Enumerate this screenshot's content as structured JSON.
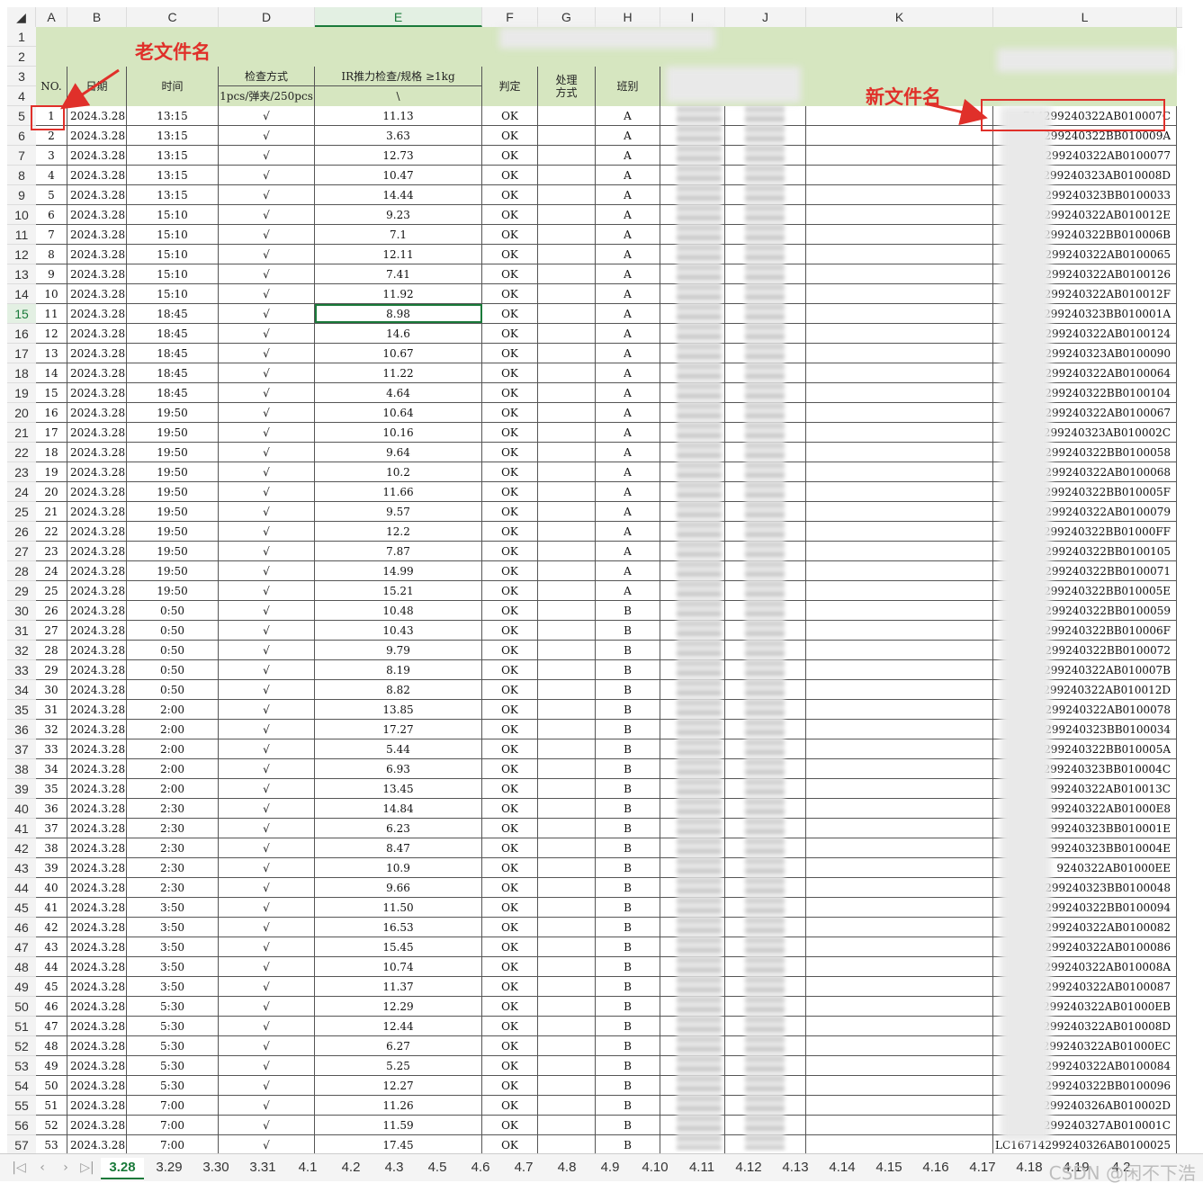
{
  "columns": [
    "A",
    "B",
    "C",
    "D",
    "E",
    "F",
    "G",
    "H",
    "I",
    "J",
    "K",
    "L"
  ],
  "selected_column": "E",
  "selected_row": "15",
  "annotations": {
    "old_name": "老文件名",
    "new_name": "新文件名"
  },
  "headers": {
    "no": "NO.",
    "date": "日期",
    "time": "时间",
    "method": "检查方式",
    "method_sub": "1pcs/弹夹/250pcs",
    "ir": "IR推力检查/规格 ≥1kg",
    "ir_sub": "\\",
    "judge": "判定",
    "handle": "处理方式",
    "shift": "班别"
  },
  "rows": [
    {
      "r": "5",
      "no": "1",
      "date": "2024.3.28",
      "time": "13:15",
      "chk": "√",
      "val": "11.13",
      "res": "OK",
      "shift": "A",
      "code": "714299240322AB010007C"
    },
    {
      "r": "6",
      "no": "2",
      "date": "2024.3.28",
      "time": "13:15",
      "chk": "√",
      "val": "3.63",
      "res": "OK",
      "shift": "A",
      "code": "714299240322BB010009A"
    },
    {
      "r": "7",
      "no": "3",
      "date": "2024.3.28",
      "time": "13:15",
      "chk": "√",
      "val": "12.73",
      "res": "OK",
      "shift": "A",
      "code": "714299240322AB0100077"
    },
    {
      "r": "8",
      "no": "4",
      "date": "2024.3.28",
      "time": "13:15",
      "chk": "√",
      "val": "10.47",
      "res": "OK",
      "shift": "A",
      "code": "714299240323AB010008D"
    },
    {
      "r": "9",
      "no": "5",
      "date": "2024.3.28",
      "time": "13:15",
      "chk": "√",
      "val": "14.44",
      "res": "OK",
      "shift": "A",
      "code": "714299240323BB0100033"
    },
    {
      "r": "10",
      "no": "6",
      "date": "2024.3.28",
      "time": "15:10",
      "chk": "√",
      "val": "9.23",
      "res": "OK",
      "shift": "A",
      "code": "714299240322AB010012E"
    },
    {
      "r": "11",
      "no": "7",
      "date": "2024.3.28",
      "time": "15:10",
      "chk": "√",
      "val": "7.1",
      "res": "OK",
      "shift": "A",
      "code": "714299240322BB010006B"
    },
    {
      "r": "12",
      "no": "8",
      "date": "2024.3.28",
      "time": "15:10",
      "chk": "√",
      "val": "12.11",
      "res": "OK",
      "shift": "A",
      "code": "714299240322AB0100065"
    },
    {
      "r": "13",
      "no": "9",
      "date": "2024.3.28",
      "time": "15:10",
      "chk": "√",
      "val": "7.41",
      "res": "OK",
      "shift": "A",
      "code": "714299240322AB0100126"
    },
    {
      "r": "14",
      "no": "10",
      "date": "2024.3.28",
      "time": "15:10",
      "chk": "√",
      "val": "11.92",
      "res": "OK",
      "shift": "A",
      "code": "14299240322AB010012F"
    },
    {
      "r": "15",
      "no": "11",
      "date": "2024.3.28",
      "time": "18:45",
      "chk": "√",
      "val": "8.98",
      "res": "OK",
      "shift": "A",
      "code": "4299240323BB010001A"
    },
    {
      "r": "16",
      "no": "12",
      "date": "2024.3.28",
      "time": "18:45",
      "chk": "√",
      "val": "14.6",
      "res": "OK",
      "shift": "A",
      "code": "4299240322AB0100124"
    },
    {
      "r": "17",
      "no": "13",
      "date": "2024.3.28",
      "time": "18:45",
      "chk": "√",
      "val": "10.67",
      "res": "OK",
      "shift": "A",
      "code": "4299240323AB0100090"
    },
    {
      "r": "18",
      "no": "14",
      "date": "2024.3.28",
      "time": "18:45",
      "chk": "√",
      "val": "11.22",
      "res": "OK",
      "shift": "A",
      "code": "4299240322AB0100064"
    },
    {
      "r": "19",
      "no": "15",
      "date": "2024.3.28",
      "time": "18:45",
      "chk": "√",
      "val": "4.64",
      "res": "OK",
      "shift": "A",
      "code": "4299240322BB0100104"
    },
    {
      "r": "20",
      "no": "16",
      "date": "2024.3.28",
      "time": "19:50",
      "chk": "√",
      "val": "10.64",
      "res": "OK",
      "shift": "A",
      "code": "4299240322AB0100067"
    },
    {
      "r": "21",
      "no": "17",
      "date": "2024.3.28",
      "time": "19:50",
      "chk": "√",
      "val": "10.16",
      "res": "OK",
      "shift": "A",
      "code": "4299240323AB010002C"
    },
    {
      "r": "22",
      "no": "18",
      "date": "2024.3.28",
      "time": "19:50",
      "chk": "√",
      "val": "9.64",
      "res": "OK",
      "shift": "A",
      "code": "4299240322BB0100058"
    },
    {
      "r": "23",
      "no": "19",
      "date": "2024.3.28",
      "time": "19:50",
      "chk": "√",
      "val": "10.2",
      "res": "OK",
      "shift": "A",
      "code": "299240322AB0100068"
    },
    {
      "r": "24",
      "no": "20",
      "date": "2024.3.28",
      "time": "19:50",
      "chk": "√",
      "val": "11.66",
      "res": "OK",
      "shift": "A",
      "code": "4299240322BB010005F"
    },
    {
      "r": "25",
      "no": "21",
      "date": "2024.3.28",
      "time": "19:50",
      "chk": "√",
      "val": "9.57",
      "res": "OK",
      "shift": "A",
      "code": "4299240322AB0100079"
    },
    {
      "r": "26",
      "no": "22",
      "date": "2024.3.28",
      "time": "19:50",
      "chk": "√",
      "val": "12.2",
      "res": "OK",
      "shift": "A",
      "code": "4299240322BB01000FF"
    },
    {
      "r": "27",
      "no": "23",
      "date": "2024.3.28",
      "time": "19:50",
      "chk": "√",
      "val": "7.87",
      "res": "OK",
      "shift": "A",
      "code": "299240322BB0100105"
    },
    {
      "r": "28",
      "no": "24",
      "date": "2024.3.28",
      "time": "19:50",
      "chk": "√",
      "val": "14.99",
      "res": "OK",
      "shift": "A",
      "code": "299240322BB0100071"
    },
    {
      "r": "29",
      "no": "25",
      "date": "2024.3.28",
      "time": "19:50",
      "chk": "√",
      "val": "15.21",
      "res": "OK",
      "shift": "A",
      "code": "299240322BB010005E"
    },
    {
      "r": "30",
      "no": "26",
      "date": "2024.3.28",
      "time": "0:50",
      "chk": "√",
      "val": "10.48",
      "res": "OK",
      "shift": "B",
      "code": "299240322BB0100059"
    },
    {
      "r": "31",
      "no": "27",
      "date": "2024.3.28",
      "time": "0:50",
      "chk": "√",
      "val": "10.43",
      "res": "OK",
      "shift": "B",
      "code": "299240322BB010006F"
    },
    {
      "r": "32",
      "no": "28",
      "date": "2024.3.28",
      "time": "0:50",
      "chk": "√",
      "val": "9.79",
      "res": "OK",
      "shift": "B",
      "code": "4299240322BB0100072"
    },
    {
      "r": "33",
      "no": "29",
      "date": "2024.3.28",
      "time": "0:50",
      "chk": "√",
      "val": "8.19",
      "res": "OK",
      "shift": "B",
      "code": "4299240322AB010007B"
    },
    {
      "r": "34",
      "no": "30",
      "date": "2024.3.28",
      "time": "0:50",
      "chk": "√",
      "val": "8.82",
      "res": "OK",
      "shift": "B",
      "code": "4299240322AB010012D"
    },
    {
      "r": "35",
      "no": "31",
      "date": "2024.3.28",
      "time": "2:00",
      "chk": "√",
      "val": "13.85",
      "res": "OK",
      "shift": "B",
      "code": "4299240322AB0100078"
    },
    {
      "r": "36",
      "no": "32",
      "date": "2024.3.28",
      "time": "2:00",
      "chk": "√",
      "val": "17.27",
      "res": "OK",
      "shift": "B",
      "code": "299240323BB0100034"
    },
    {
      "r": "37",
      "no": "33",
      "date": "2024.3.28",
      "time": "2:00",
      "chk": "√",
      "val": "5.44",
      "res": "OK",
      "shift": "B",
      "code": "299240322BB010005A"
    },
    {
      "r": "38",
      "no": "34",
      "date": "2024.3.28",
      "time": "2:00",
      "chk": "√",
      "val": "6.93",
      "res": "OK",
      "shift": "B",
      "code": "299240323BB010004C"
    },
    {
      "r": "39",
      "no": "35",
      "date": "2024.3.28",
      "time": "2:00",
      "chk": "√",
      "val": "13.45",
      "res": "OK",
      "shift": "B",
      "code": "99240322AB010013C"
    },
    {
      "r": "40",
      "no": "36",
      "date": "2024.3.28",
      "time": "2:30",
      "chk": "√",
      "val": "14.84",
      "res": "OK",
      "shift": "B",
      "code": "99240322AB01000E8"
    },
    {
      "r": "41",
      "no": "37",
      "date": "2024.3.28",
      "time": "2:30",
      "chk": "√",
      "val": "6.23",
      "res": "OK",
      "shift": "B",
      "code": "99240323BB010001E"
    },
    {
      "r": "42",
      "no": "38",
      "date": "2024.3.28",
      "time": "2:30",
      "chk": "√",
      "val": "8.47",
      "res": "OK",
      "shift": "B",
      "code": "99240323BB010004E"
    },
    {
      "r": "43",
      "no": "39",
      "date": "2024.3.28",
      "time": "2:30",
      "chk": "√",
      "val": "10.9",
      "res": "OK",
      "shift": "B",
      "code": "9240322AB01000EE"
    },
    {
      "r": "44",
      "no": "40",
      "date": "2024.3.28",
      "time": "2:30",
      "chk": "√",
      "val": "9.66",
      "res": "OK",
      "shift": "B",
      "code": "4299240323BB0100048"
    },
    {
      "r": "45",
      "no": "41",
      "date": "2024.3.28",
      "time": "3:50",
      "chk": "√",
      "val": "11.50",
      "res": "OK",
      "shift": "B",
      "code": "714299240322BB0100094"
    },
    {
      "r": "46",
      "no": "42",
      "date": "2024.3.28",
      "time": "3:50",
      "chk": "√",
      "val": "16.53",
      "res": "OK",
      "shift": "B",
      "code": "714299240322AB0100082"
    },
    {
      "r": "47",
      "no": "43",
      "date": "2024.3.28",
      "time": "3:50",
      "chk": "√",
      "val": "15.45",
      "res": "OK",
      "shift": "B",
      "code": "14299240322AB0100086"
    },
    {
      "r": "48",
      "no": "44",
      "date": "2024.3.28",
      "time": "3:50",
      "chk": "√",
      "val": "10.74",
      "res": "OK",
      "shift": "B",
      "code": "14299240322AB010008A"
    },
    {
      "r": "49",
      "no": "45",
      "date": "2024.3.28",
      "time": "3:50",
      "chk": "√",
      "val": "11.37",
      "res": "OK",
      "shift": "B",
      "code": "14299240322AB0100087"
    },
    {
      "r": "50",
      "no": "46",
      "date": "2024.3.28",
      "time": "5:30",
      "chk": "√",
      "val": "12.29",
      "res": "OK",
      "shift": "B",
      "code": "14299240322AB01000EB"
    },
    {
      "r": "51",
      "no": "47",
      "date": "2024.3.28",
      "time": "5:30",
      "chk": "√",
      "val": "12.44",
      "res": "OK",
      "shift": "B",
      "code": "4299240322AB010008D"
    },
    {
      "r": "52",
      "no": "48",
      "date": "2024.3.28",
      "time": "5:30",
      "chk": "√",
      "val": "6.27",
      "res": "OK",
      "shift": "B",
      "code": "4299240322AB01000EC"
    },
    {
      "r": "53",
      "no": "49",
      "date": "2024.3.28",
      "time": "5:30",
      "chk": "√",
      "val": "5.25",
      "res": "OK",
      "shift": "B",
      "code": "4299240322AB0100084"
    },
    {
      "r": "54",
      "no": "50",
      "date": "2024.3.28",
      "time": "5:30",
      "chk": "√",
      "val": "12.27",
      "res": "OK",
      "shift": "B",
      "code": "4299240322BB0100096"
    },
    {
      "r": "55",
      "no": "51",
      "date": "2024.3.28",
      "time": "7:00",
      "chk": "√",
      "val": "11.26",
      "res": "OK",
      "shift": "B",
      "code": "4299240326AB010002D"
    },
    {
      "r": "56",
      "no": "52",
      "date": "2024.3.28",
      "time": "7:00",
      "chk": "√",
      "val": "11.59",
      "res": "OK",
      "shift": "B",
      "code": "14299240327AB010001C"
    },
    {
      "r": "57",
      "no": "53",
      "date": "2024.3.28",
      "time": "7:00",
      "chk": "√",
      "val": "17.45",
      "res": "OK",
      "shift": "B",
      "code": "LC1671429924032​6AB0100025"
    }
  ],
  "sheet_tabs": [
    "3.28",
    "3.29",
    "3.30",
    "3.31",
    "4.1",
    "4.2",
    "4.3",
    "4.5",
    "4.6",
    "4.7",
    "4.8",
    "4.9",
    "4.10",
    "4.11",
    "4.12",
    "4.13",
    "4.14",
    "4.15",
    "4.16",
    "4.17",
    "4.18",
    "4.19",
    "4.2"
  ],
  "active_tab": "3.28",
  "watermark": "CSDN @闲不下浩",
  "colors": {
    "accent": "#1a7a3a",
    "title_band": "#d6e6c0",
    "annotation_red": "#e0302a"
  },
  "icons": {
    "first": "first-sheet-icon",
    "prev": "prev-sheet-icon",
    "next": "next-sheet-icon",
    "last": "last-sheet-icon"
  }
}
